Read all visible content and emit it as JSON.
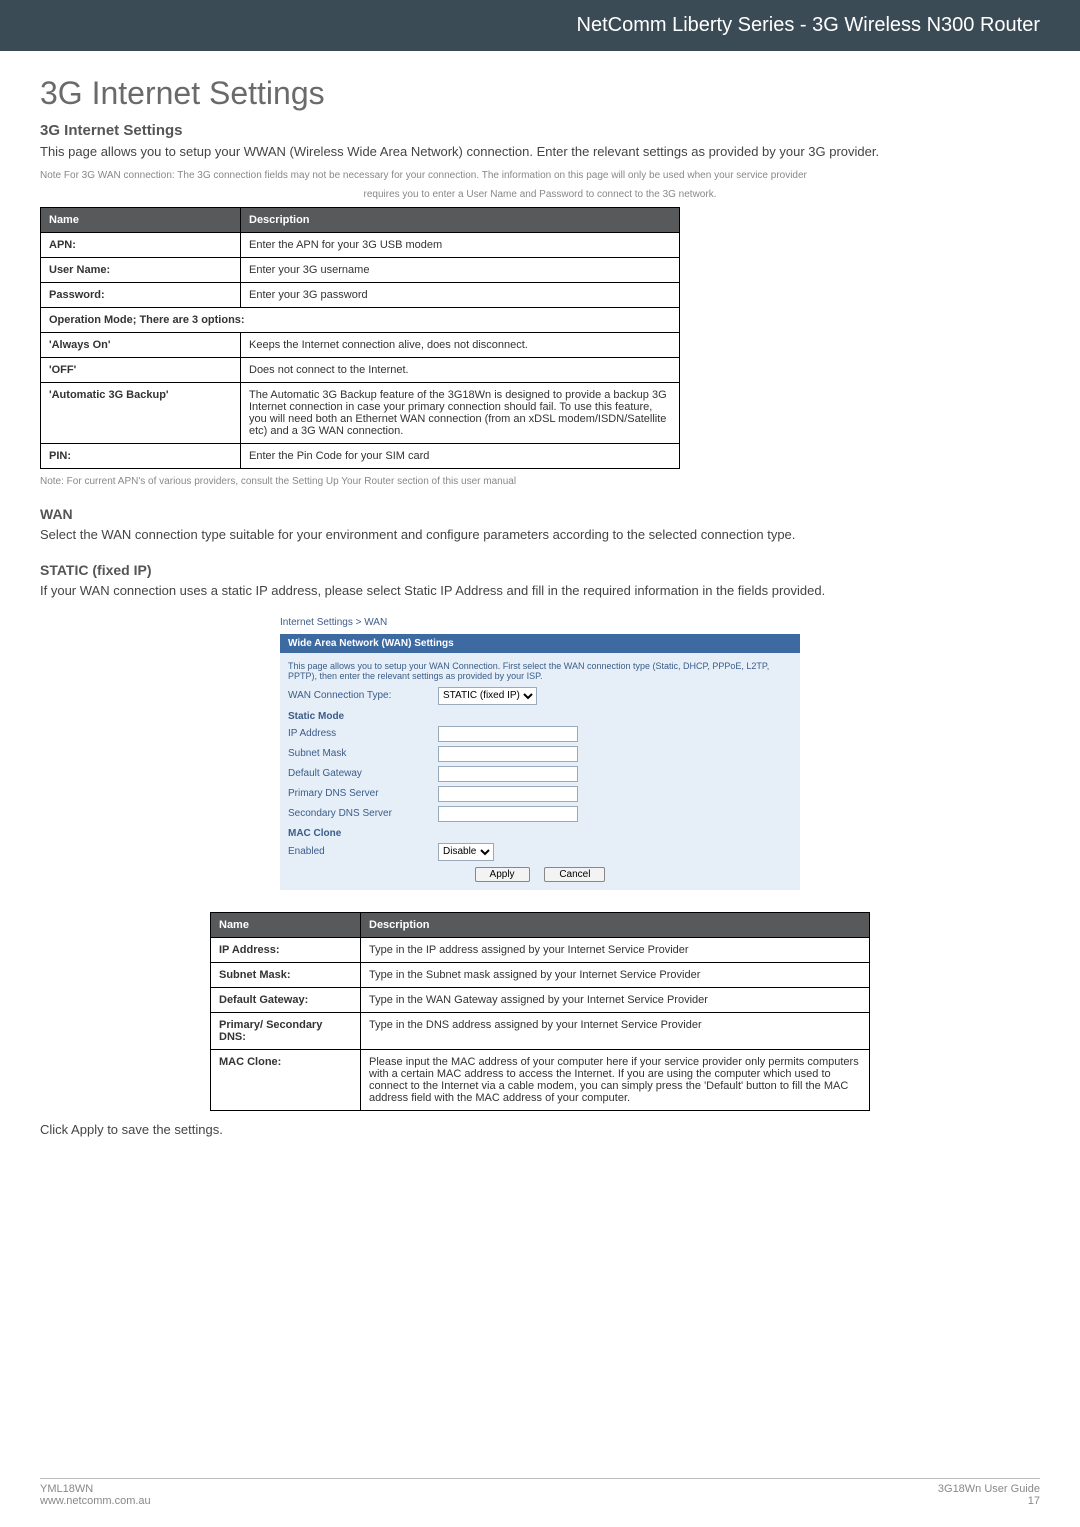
{
  "header": {
    "title": "NetComm Liberty Series - 3G Wireless N300 Router"
  },
  "h1": "3G Internet Settings",
  "section1": {
    "heading": "3G Internet Settings",
    "intro": "This page allows you to setup your WWAN (Wireless Wide Area Network) connection. Enter the relevant settings as provided by your 3G provider.",
    "note_line1": "Note For 3G WAN connection: The 3G connection fields may not be necessary for your connection. The information on this page will only be used when your service provider",
    "note_line2": "requires you to enter a User Name and Password to connect to the 3G network."
  },
  "table1": {
    "head_name": "Name",
    "head_desc": "Description",
    "rows": [
      {
        "name": "APN:",
        "desc": "Enter the APN for your 3G USB modem"
      },
      {
        "name": "User Name:",
        "desc": "Enter your 3G username"
      },
      {
        "name": "Password:",
        "desc": "Enter your 3G password"
      }
    ],
    "span_row": "Operation Mode; There are 3 options:",
    "rows2": [
      {
        "name": "'Always On'",
        "desc": "Keeps the Internet connection alive, does not disconnect."
      },
      {
        "name": "'OFF'",
        "desc": "Does not connect to the Internet."
      },
      {
        "name": "'Automatic 3G Backup'",
        "desc": "The Automatic 3G Backup feature of the 3G18Wn is designed to provide a backup 3G Internet connection in case your primary connection should fail. To use this feature, you will need both an Ethernet WAN connection (from an xDSL modem/ISDN/Satellite etc) and a 3G WAN connection."
      },
      {
        "name": "PIN:",
        "desc": "Enter the Pin Code for your SIM card"
      }
    ],
    "after_note": "Note: For current APN's of various providers, consult the Setting Up Your Router section of this user manual"
  },
  "wan": {
    "heading": "WAN",
    "intro": "Select the WAN connection type suitable for your environment and configure parameters according to the selected connection type."
  },
  "static": {
    "heading": "STATIC (fixed IP)",
    "intro": "If your WAN connection uses a static IP address, please select Static IP Address and fill in the required information in the fields provided."
  },
  "shot": {
    "crumb": "Internet Settings > WAN",
    "panel_title": "Wide Area Network (WAN) Settings",
    "hint": "This page allows you to setup your WAN Connection. First select the WAN connection type (Static, DHCP, PPPoE, L2TP, PPTP), then enter the relevant settings as provided by your ISP.",
    "wan_type_label": "WAN Connection Type:",
    "wan_type_value": "STATIC (fixed IP)",
    "static_mode_label": "Static Mode",
    "ip_label": "IP Address",
    "subnet_label": "Subnet Mask",
    "gateway_label": "Default Gateway",
    "pdns_label": "Primary DNS Server",
    "sdns_label": "Secondary DNS Server",
    "mac_clone_label": "MAC Clone",
    "enabled_label": "Enabled",
    "enabled_value": "Disable",
    "apply": "Apply",
    "cancel": "Cancel"
  },
  "table2": {
    "head_name": "Name",
    "head_desc": "Description",
    "rows": [
      {
        "name": "IP Address:",
        "desc": "Type in the IP address assigned by your Internet Service Provider"
      },
      {
        "name": "Subnet Mask:",
        "desc": "Type in the Subnet mask assigned by your Internet Service Provider"
      },
      {
        "name": "Default Gateway:",
        "desc": "Type in the WAN Gateway assigned by your Internet Service Provider"
      },
      {
        "name": "Primary/ Secondary DNS:",
        "desc": "Type in the DNS address assigned by your Internet Service Provider"
      },
      {
        "name": "MAC Clone:",
        "desc": "Please input the MAC address of your computer here if your service provider only permits computers with a certain MAC address to access the Internet. If you are using the computer which used to connect to the Internet via a cable modem, you can simply press the 'Default' button to fill the MAC address field with the MAC address of your computer."
      }
    ]
  },
  "apply_line": "Click Apply to save the settings.",
  "footer": {
    "left1": "YML18WN",
    "left2": "www.netcomm.com.au",
    "right1": "3G18Wn User Guide",
    "right2": "17"
  }
}
